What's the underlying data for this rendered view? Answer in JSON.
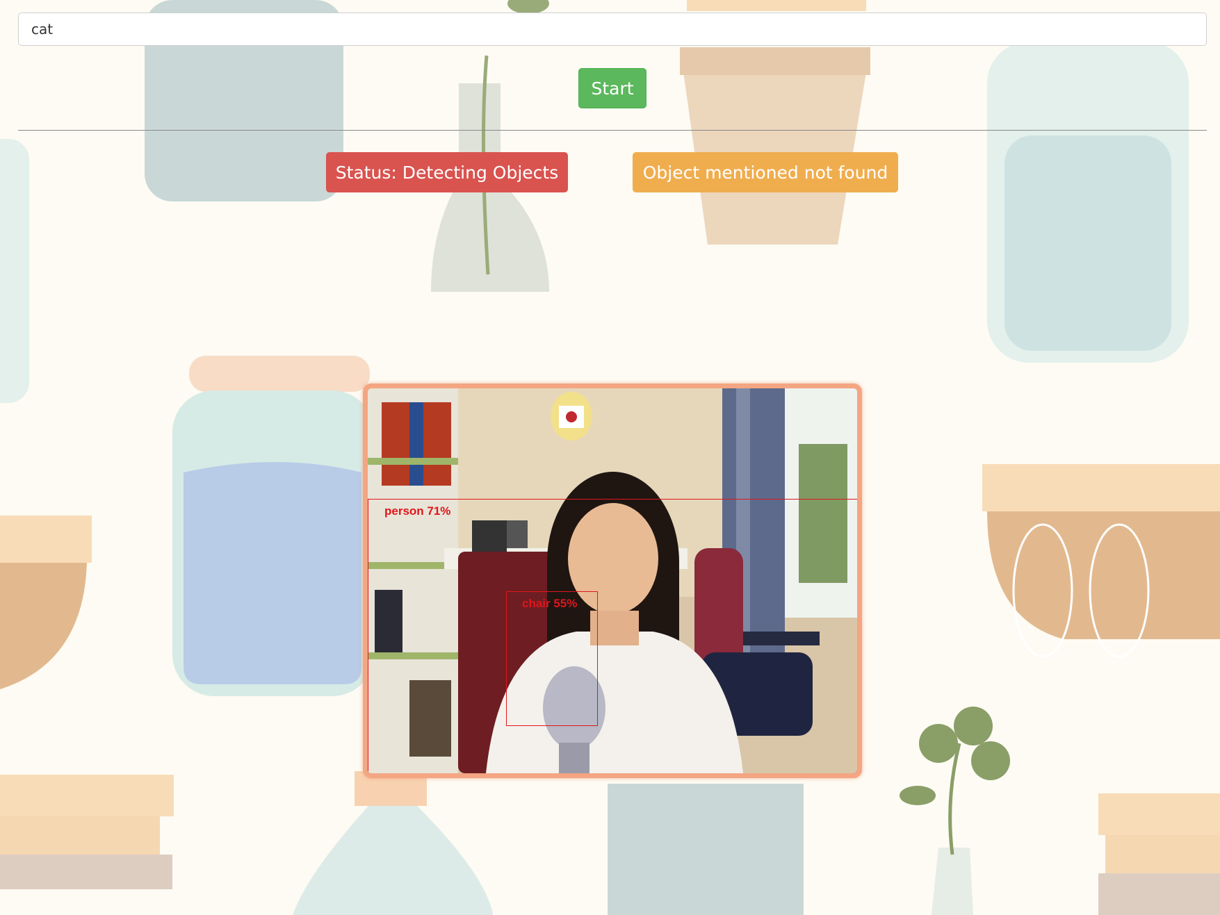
{
  "search": {
    "value": "cat",
    "placeholder": ""
  },
  "controls": {
    "start_label": "Start"
  },
  "status": {
    "text": "Status: Detecting Objects",
    "color": "#d9534f"
  },
  "result": {
    "text": "Object mentioned not found",
    "color": "#f0ad4e"
  },
  "detections": [
    {
      "label": "person 71%"
    },
    {
      "label": "chair 55%"
    }
  ],
  "colors": {
    "background": "#fdfbf3",
    "start": "#5cb85c",
    "frame_border": "#f4a582",
    "detection": "#e0151b"
  }
}
